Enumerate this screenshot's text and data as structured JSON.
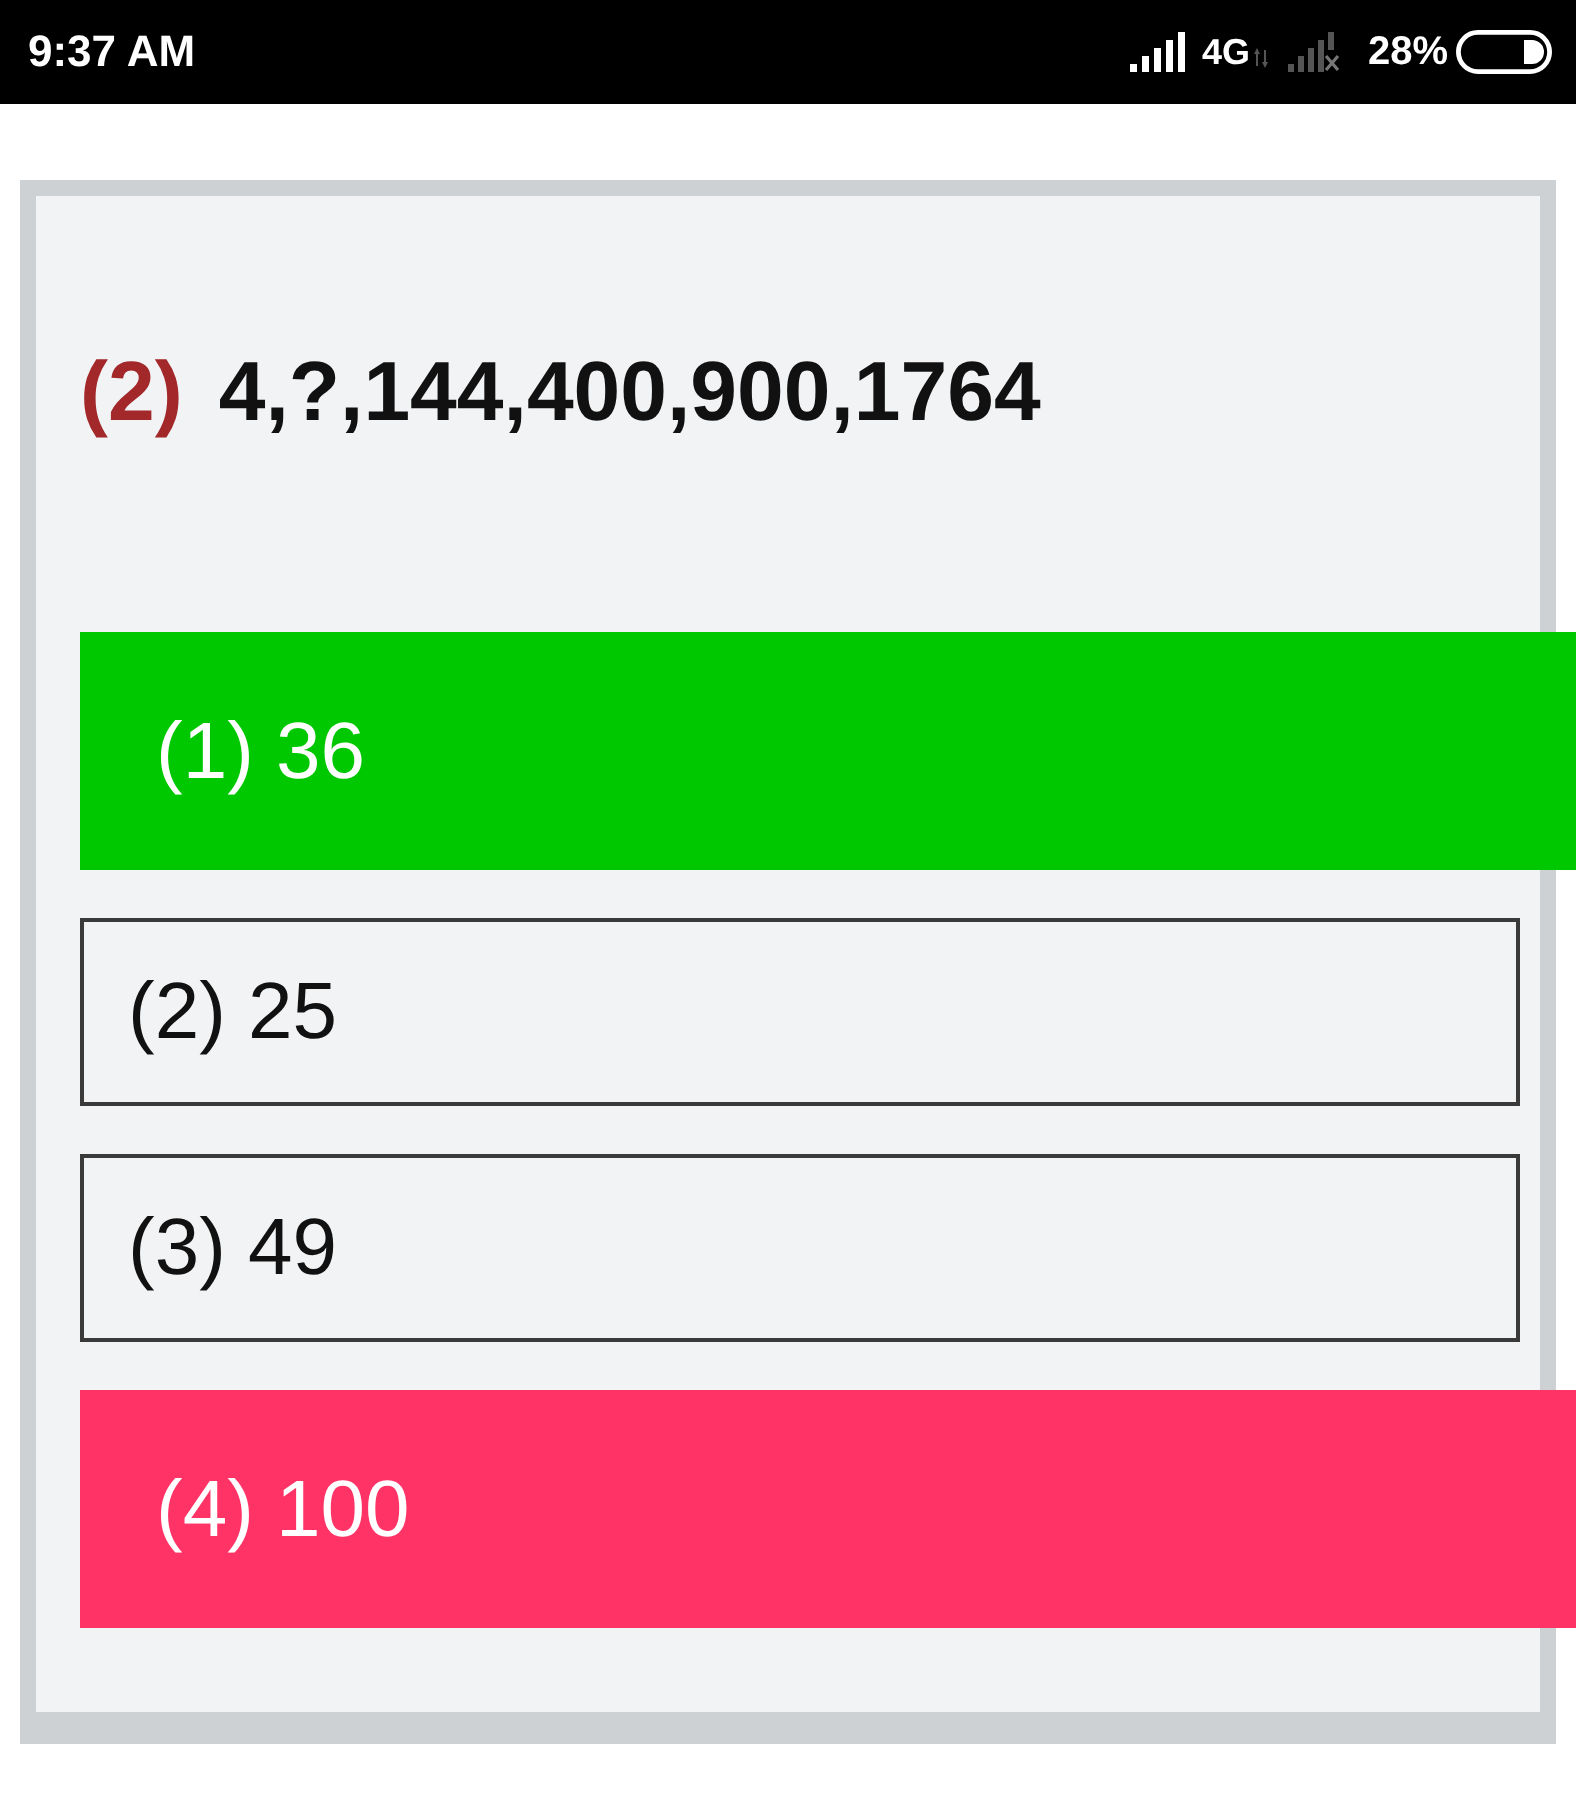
{
  "status_bar": {
    "time": "9:37 AM",
    "network": "4G",
    "battery": "28%"
  },
  "question": {
    "number": "(2)",
    "text": "4,?,144,400,900,1764"
  },
  "options": [
    {
      "label": "(1) 36",
      "kind": "correct"
    },
    {
      "label": "(2) 25",
      "kind": "plain"
    },
    {
      "label": "(3) 49",
      "kind": "plain"
    },
    {
      "label": "(4) 100",
      "kind": "wrong"
    }
  ]
}
